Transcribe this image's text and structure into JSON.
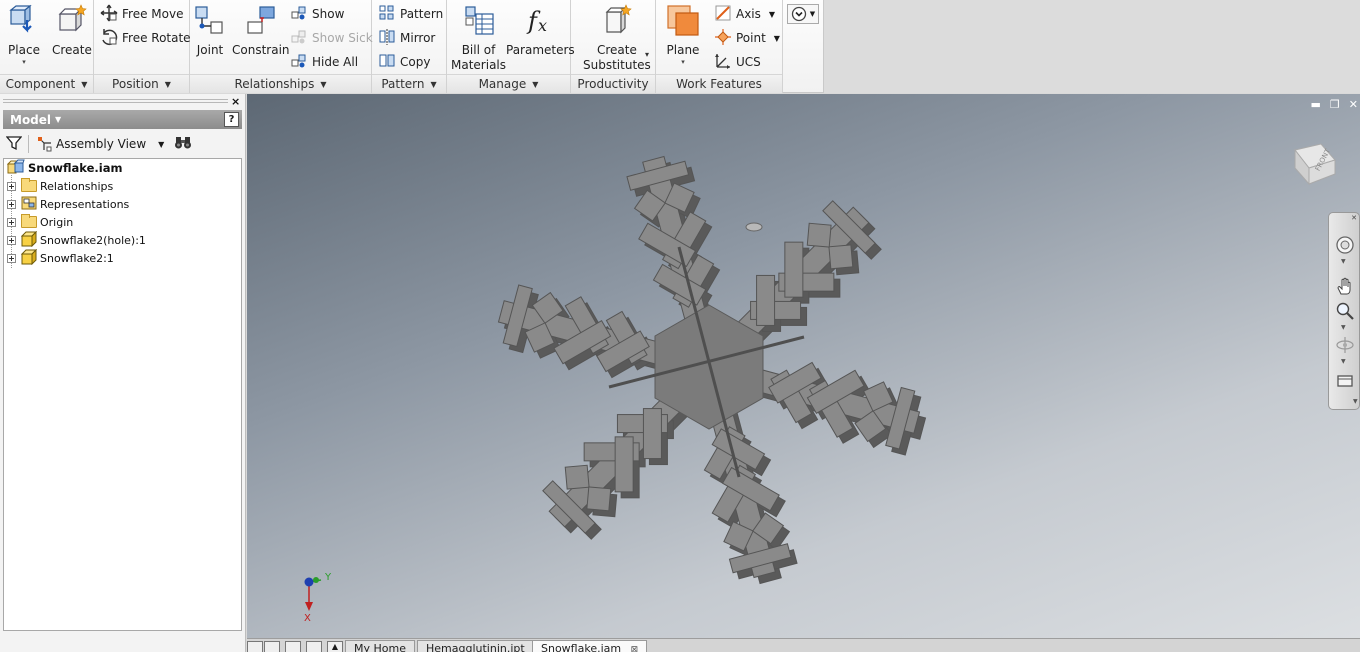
{
  "ribbon": {
    "component": {
      "place": "Place",
      "create": "Create",
      "footer": "Component"
    },
    "position": {
      "free_move": "Free Move",
      "free_rotate": "Free Rotate",
      "footer": "Position"
    },
    "relationships": {
      "joint": "Joint",
      "constrain": "Constrain",
      "show": "Show",
      "show_sick": "Show Sick",
      "hide_all": "Hide All",
      "footer": "Relationships"
    },
    "pattern": {
      "pattern": "Pattern",
      "mirror": "Mirror",
      "copy": "Copy",
      "footer": "Pattern"
    },
    "manage": {
      "bill_line1": "Bill of",
      "bill_line2": "Materials",
      "parameters": "Parameters",
      "footer": "Manage"
    },
    "productivity": {
      "create_line1": "Create",
      "create_line2": "Substitutes",
      "footer": "Productivity"
    },
    "work_features": {
      "plane": "Plane",
      "axis": "Axis",
      "point": "Point",
      "ucs": "UCS",
      "footer": "Work Features"
    }
  },
  "browser": {
    "title": "Model",
    "help": "?",
    "close": "×",
    "view_label": "Assembly View",
    "tree": {
      "root": "Snowflake.iam",
      "items": [
        {
          "label": "Relationships",
          "icon": "folder-icon"
        },
        {
          "label": "Representations",
          "icon": "representations-icon"
        },
        {
          "label": "Origin",
          "icon": "folder-icon"
        },
        {
          "label": "Snowflake2(hole):1",
          "icon": "part-icon"
        },
        {
          "label": "Snowflake2:1",
          "icon": "part-icon"
        }
      ]
    }
  },
  "viewport": {
    "viewcube_face": "FRONT",
    "triad_y": "Y",
    "triad_x": "X",
    "colors": {
      "bg_top": "#5d6874",
      "bg_bottom": "#dcdfe2",
      "model": "#7e7e7e"
    }
  },
  "tabs": [
    {
      "label": "My Home",
      "active": false
    },
    {
      "label": "Hemagglutinin.ipt",
      "active": false
    },
    {
      "label": "Snowflake.iam",
      "active": true
    }
  ]
}
